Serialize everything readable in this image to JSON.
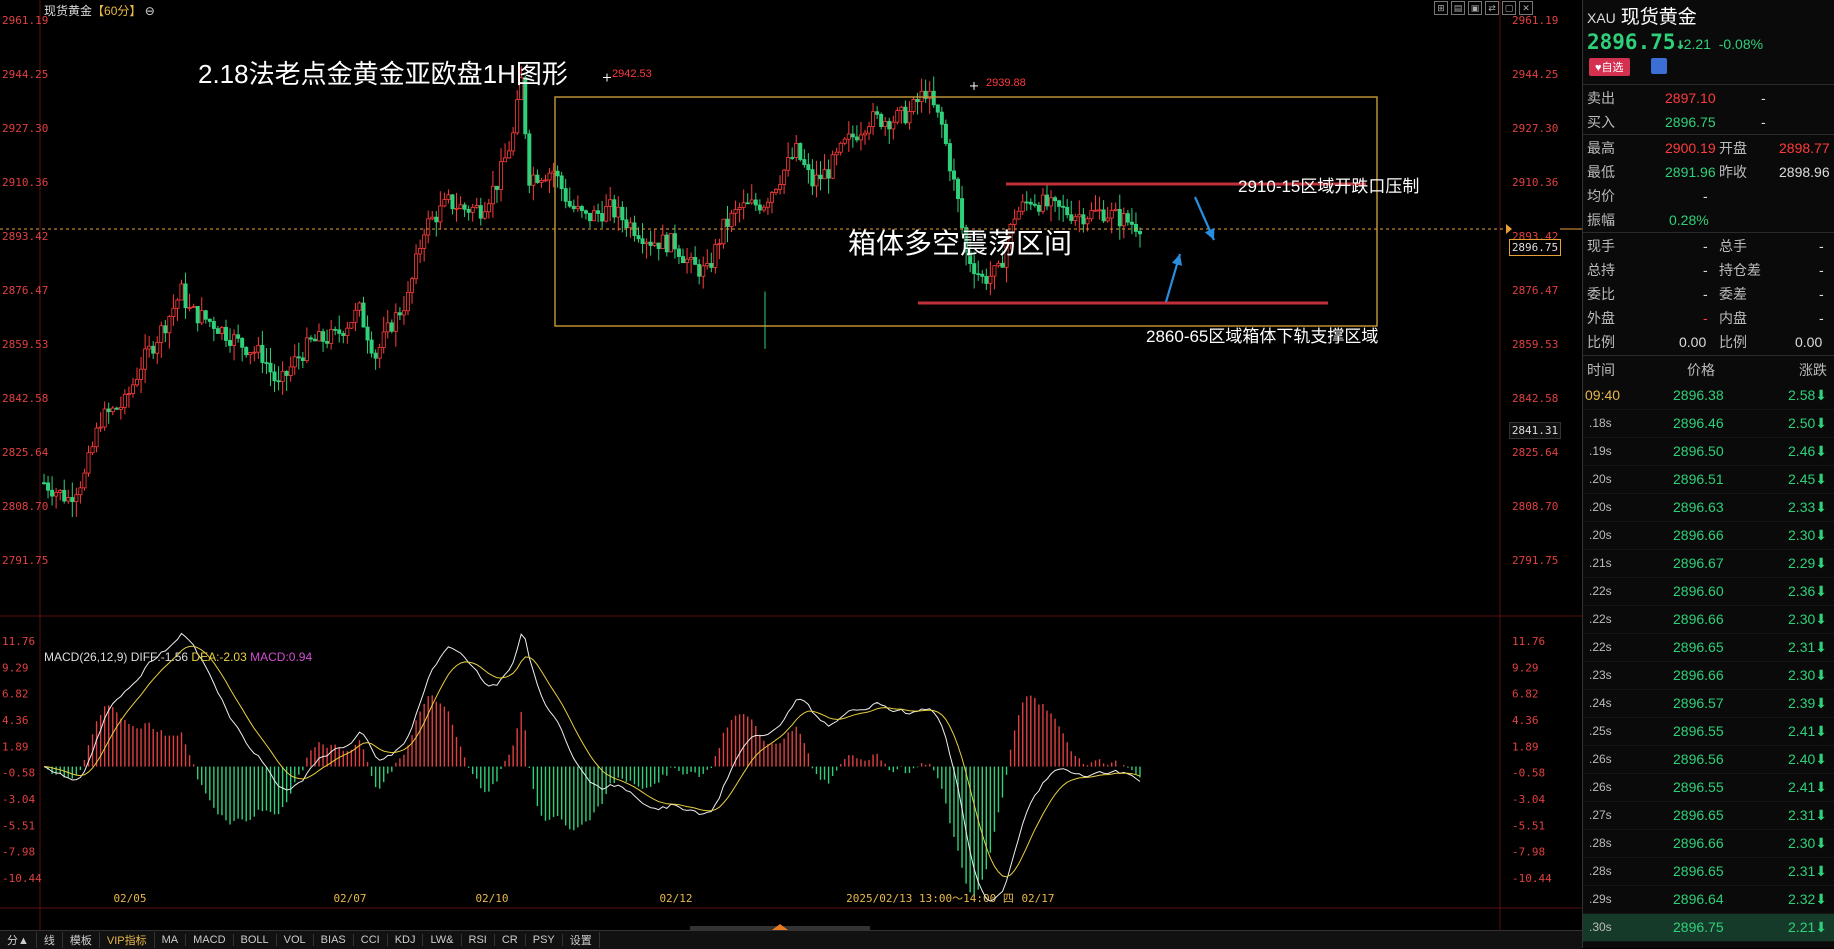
{
  "window": {
    "symbol": "现货黄金",
    "period": "【60分】",
    "period_icon": "circle-minus-icon"
  },
  "annotations": {
    "title": "2.18法老点金黄金亚欧盘1H图形",
    "box_label": "箱体多空震荡区间",
    "resistance_label": "2910-15区域开跌口压制",
    "support_label": "2860-65区域箱体下轨支撑区域",
    "peak1": "2942.53",
    "peak2": "2939.88"
  },
  "current_price_box": "2896.75",
  "alt_price_box": "2841.31",
  "macd_header": {
    "name": "MACD(26,12,9)",
    "diff": "DIFF:-1.56",
    "dea": "DEA:-2.03",
    "macd": "MACD:0.94"
  },
  "chart_data": [
    {
      "type": "candlestick",
      "y_ticks": [
        "2961.19",
        "2944.25",
        "2927.30",
        "2910.36",
        "2893.42",
        "2876.47",
        "2859.53",
        "2842.58",
        "2825.64",
        "2808.70",
        "2791.75"
      ],
      "x_labels": [
        "02/05",
        "02/07",
        "02/10",
        "02/12",
        "2025/02/13 13:00～14:00 四",
        "02/17"
      ],
      "ylim": [
        2791.75,
        2961.19
      ],
      "levels": {
        "resistance": 2911.5,
        "support": 2870.5,
        "box_top": 2935,
        "box_bottom": 2865,
        "current": 2896.75
      },
      "ohlc_anchor": [
        [
          0,
          2816
        ],
        [
          6,
          2811
        ],
        [
          10,
          2818
        ],
        [
          14,
          2836
        ],
        [
          20,
          2841
        ],
        [
          24,
          2853
        ],
        [
          30,
          2866
        ],
        [
          34,
          2876
        ],
        [
          36,
          2870
        ],
        [
          42,
          2866
        ],
        [
          48,
          2860
        ],
        [
          54,
          2856
        ],
        [
          58,
          2846
        ],
        [
          62,
          2854
        ],
        [
          66,
          2860
        ],
        [
          72,
          2862
        ],
        [
          78,
          2870
        ],
        [
          82,
          2856
        ],
        [
          86,
          2866
        ],
        [
          90,
          2874
        ],
        [
          94,
          2896
        ],
        [
          100,
          2904
        ],
        [
          104,
          2902
        ],
        [
          108,
          2902
        ],
        [
          112,
          2910
        ],
        [
          116,
          2925
        ],
        [
          118,
          2942
        ],
        [
          120,
          2912
        ],
        [
          126,
          2914
        ],
        [
          130,
          2903
        ],
        [
          134,
          2899
        ],
        [
          140,
          2902
        ],
        [
          146,
          2896
        ],
        [
          150,
          2892
        ],
        [
          156,
          2891
        ],
        [
          160,
          2884
        ],
        [
          164,
          2882
        ],
        [
          168,
          2896
        ],
        [
          172,
          2902
        ],
        [
          178,
          2904
        ],
        [
          182,
          2912
        ],
        [
          186,
          2920
        ],
        [
          190,
          2910
        ],
        [
          194,
          2914
        ],
        [
          198,
          2922
        ],
        [
          204,
          2930
        ],
        [
          210,
          2930
        ],
        [
          214,
          2932
        ],
        [
          218,
          2939
        ],
        [
          222,
          2928
        ],
        [
          226,
          2904
        ],
        [
          228,
          2888
        ],
        [
          232,
          2880
        ],
        [
          236,
          2882
        ],
        [
          240,
          2900
        ],
        [
          244,
          2905
        ],
        [
          250,
          2902
        ],
        [
          256,
          2900
        ],
        [
          262,
          2901
        ],
        [
          266,
          2899
        ],
        [
          270,
          2897
        ]
      ]
    },
    {
      "type": "macd",
      "y_ticks": [
        "11.76",
        "9.29",
        "6.82",
        "4.36",
        "1.89",
        "-0.58",
        "-3.04",
        "-5.51",
        "-7.98",
        "-10.44"
      ],
      "ylim": [
        -12.5,
        11.76
      ]
    }
  ],
  "toolbar_tabs": [
    "分▲",
    "线",
    "模板",
    "VIP指标",
    "MA",
    "MACD",
    "BOLL",
    "VOL",
    "BIAS",
    "CCI",
    "KDJ",
    "LW&",
    "RSI",
    "CR",
    "PSY",
    "设置"
  ],
  "panel": {
    "sym": "XAU",
    "name": "现货黄金",
    "price": "2896.75",
    "arrow": "↓",
    "change": "-2.21",
    "pct": "-0.08%",
    "fav": "自选",
    "bell_icon": "bell-icon",
    "sell_label": "卖出",
    "sell": "2897.10",
    "sell_q": "-",
    "buy_label": "买入",
    "buy": "2896.75",
    "buy_q": "-",
    "high_label": "最高",
    "high": "2900.19",
    "open_label": "开盘",
    "open": "2898.77",
    "low_label": "最低",
    "low": "2891.96",
    "prev_label": "昨收",
    "prev": "2898.96",
    "avg_label": "均价",
    "avg": "-",
    "amp_label": "振幅",
    "amp": "0.28%",
    "now_label": "现手",
    "now": "-",
    "total_label": "总手",
    "total": "-",
    "hold_label": "总持",
    "hold": "-",
    "holddiff_label": "持仓差",
    "holddiff": "-",
    "ratio_label": "委比",
    "ratio": "-",
    "diff_label": "委差",
    "diff": "-",
    "outer_label": "外盘",
    "outer": "-",
    "inner_label": "内盘",
    "inner": "-",
    "r1_label": "比例",
    "r1": "0.00",
    "r2_label": "比例",
    "r2": "0.00",
    "col_time": "时间",
    "col_price": "价格",
    "col_chg": "涨跌",
    "ticks": [
      {
        "t": "09:40",
        "p": "2896.38",
        "c": "2.58"
      },
      {
        "t": ".18s",
        "p": "2896.46",
        "c": "2.50"
      },
      {
        "t": ".19s",
        "p": "2896.50",
        "c": "2.46"
      },
      {
        "t": ".20s",
        "p": "2896.51",
        "c": "2.45"
      },
      {
        "t": ".20s",
        "p": "2896.63",
        "c": "2.33"
      },
      {
        "t": ".20s",
        "p": "2896.66",
        "c": "2.30"
      },
      {
        "t": ".21s",
        "p": "2896.67",
        "c": "2.29"
      },
      {
        "t": ".22s",
        "p": "2896.60",
        "c": "2.36"
      },
      {
        "t": ".22s",
        "p": "2896.66",
        "c": "2.30"
      },
      {
        "t": ".22s",
        "p": "2896.65",
        "c": "2.31"
      },
      {
        "t": ".23s",
        "p": "2896.66",
        "c": "2.30"
      },
      {
        "t": ".24s",
        "p": "2896.57",
        "c": "2.39"
      },
      {
        "t": ".25s",
        "p": "2896.55",
        "c": "2.41"
      },
      {
        "t": ".26s",
        "p": "2896.56",
        "c": "2.40"
      },
      {
        "t": ".26s",
        "p": "2896.55",
        "c": "2.41"
      },
      {
        "t": ".27s",
        "p": "2896.65",
        "c": "2.31"
      },
      {
        "t": ".28s",
        "p": "2896.66",
        "c": "2.30"
      },
      {
        "t": ".28s",
        "p": "2896.65",
        "c": "2.31"
      },
      {
        "t": ".29s",
        "p": "2896.64",
        "c": "2.32"
      },
      {
        "t": ".30s",
        "p": "2896.75",
        "c": "2.21"
      }
    ]
  }
}
